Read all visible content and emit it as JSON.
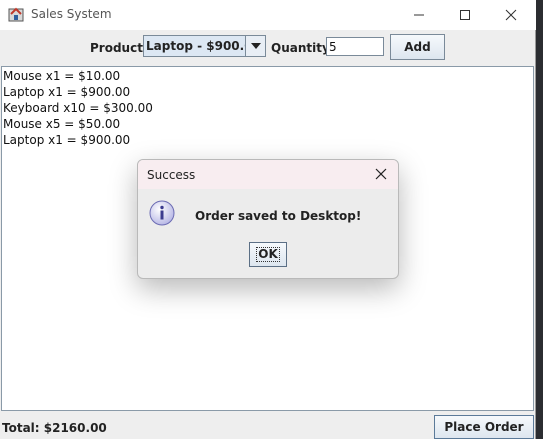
{
  "window": {
    "title": "Sales System"
  },
  "toolbar": {
    "product_label": "Product:",
    "product_selected": "Laptop - $900.0",
    "quantity_label": "Quantity:",
    "quantity_value": "5",
    "add_label": "Add"
  },
  "order_lines": [
    "Mouse x1 = $10.00",
    "Laptop x1 = $900.00",
    "Keyboard x10 = $300.00",
    "Mouse x5 = $50.00",
    "Laptop x1 = $900.00"
  ],
  "footer": {
    "total": "Total: $2160.00",
    "place_order_label": "Place Order"
  },
  "dialog": {
    "title": "Success",
    "message": "Order saved to Desktop!",
    "ok_label": "OK",
    "icon": "info-icon"
  },
  "icons": [
    "app-icon",
    "minimize-icon",
    "maximize-icon",
    "close-icon",
    "chevron-down-icon",
    "info-icon"
  ]
}
